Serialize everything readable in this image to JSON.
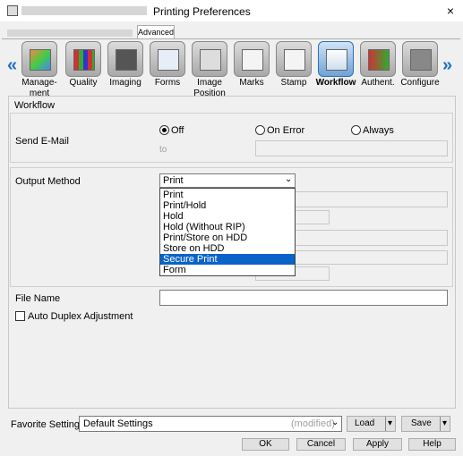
{
  "window": {
    "title": "Printing Preferences",
    "close_label": "×"
  },
  "tabs": {
    "advanced": "Advanced"
  },
  "nav": {
    "left_arrow": "«",
    "right_arrow": "»"
  },
  "toolbar_items": [
    {
      "label_line1": "Manage-",
      "label_line2": "ment",
      "icon": "management-icon"
    },
    {
      "label_line1": "Quality",
      "label_line2": "",
      "icon": "quality-icon"
    },
    {
      "label_line1": "Imaging",
      "label_line2": "",
      "icon": "imaging-icon"
    },
    {
      "label_line1": "Forms",
      "label_line2": "",
      "icon": "forms-icon"
    },
    {
      "label_line1": "Image",
      "label_line2": "Position",
      "icon": "image-position-icon"
    },
    {
      "label_line1": "Marks",
      "label_line2": "",
      "icon": "marks-icon"
    },
    {
      "label_line1": "Stamp",
      "label_line2": "",
      "icon": "stamp-icon"
    },
    {
      "label_line1": "Workflow",
      "label_line2": "",
      "icon": "workflow-icon",
      "active": true
    },
    {
      "label_line1": "Authent.",
      "label_line2": "",
      "icon": "authentication-icon"
    },
    {
      "label_line1": "Configure",
      "label_line2": "",
      "icon": "configure-icon"
    }
  ],
  "workflow": {
    "section_title": "Workflow",
    "send_email": {
      "label": "Send E-Mail",
      "options": [
        "Off",
        "On Error",
        "Always"
      ],
      "selected": "Off",
      "to_label": "to"
    },
    "output_method": {
      "label": "Output Method",
      "value": "Print",
      "options": [
        "Print",
        "Print/Hold",
        "Hold",
        "Hold (Without RIP)",
        "Print/Store on HDD",
        "Store on HDD",
        "Secure Print",
        "Form"
      ],
      "highlighted": "Secure Print"
    },
    "file_name": {
      "label": "File Name",
      "value": ""
    },
    "auto_duplex": {
      "label": "Auto Duplex Adjustment",
      "checked": false
    }
  },
  "favorite": {
    "label": "Favorite Setting",
    "value": "Default Settings",
    "modified": "(modified)",
    "load": "Load",
    "save": "Save"
  },
  "buttons": {
    "ok": "OK",
    "cancel": "Cancel",
    "apply": "Apply",
    "help": "Help"
  },
  "colors": {
    "accent": "#0a64c8",
    "arrow": "#1c6fc4"
  }
}
